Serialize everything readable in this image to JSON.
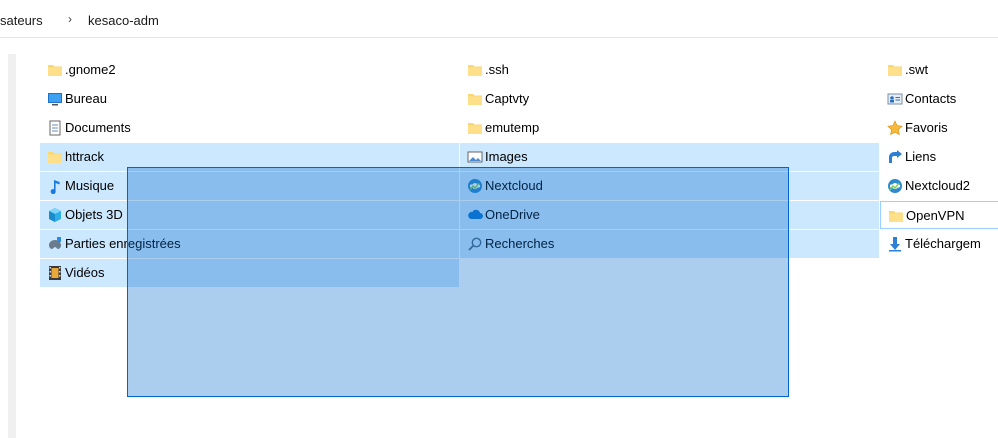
{
  "breadcrumb": {
    "segments": [
      "sateurs",
      "kesaco-adm"
    ],
    "separator": "›"
  },
  "columns": [
    [
      {
        "label": ".gnome2",
        "icon": "folder-icon",
        "selected": false
      },
      {
        "label": "Bureau",
        "icon": "desktop-icon",
        "selected": false
      },
      {
        "label": "Documents",
        "icon": "documents-icon",
        "selected": false
      },
      {
        "label": "httrack",
        "icon": "folder-icon",
        "selected": true
      },
      {
        "label": "Musique",
        "icon": "music-icon",
        "selected": true
      },
      {
        "label": "Objets 3D",
        "icon": "objects-3d-icon",
        "selected": true
      },
      {
        "label": "Parties enregistrées",
        "icon": "saved-games-icon",
        "selected": true
      },
      {
        "label": "Vidéos",
        "icon": "videos-icon",
        "selected": true
      }
    ],
    [
      {
        "label": ".ssh",
        "icon": "folder-icon",
        "selected": false
      },
      {
        "label": "Captvty",
        "icon": "folder-icon",
        "selected": false
      },
      {
        "label": "emutemp",
        "icon": "folder-icon",
        "selected": false
      },
      {
        "label": "Images",
        "icon": "pictures-icon",
        "selected": true
      },
      {
        "label": "Nextcloud",
        "icon": "nextcloud-icon",
        "selected": true
      },
      {
        "label": "OneDrive",
        "icon": "onedrive-icon",
        "selected": true
      },
      {
        "label": "Recherches",
        "icon": "searches-icon",
        "selected": true
      }
    ],
    [
      {
        "label": ".swt",
        "icon": "folder-icon",
        "selected": false
      },
      {
        "label": "Contacts",
        "icon": "contacts-icon",
        "selected": false
      },
      {
        "label": "Favoris",
        "icon": "favorites-icon",
        "selected": false
      },
      {
        "label": "Liens",
        "icon": "links-icon",
        "selected": false
      },
      {
        "label": "Nextcloud2",
        "icon": "nextcloud-icon",
        "selected": false
      },
      {
        "label": "OpenVPN",
        "icon": "folder-icon",
        "selected": false
      },
      {
        "label": "Téléchargem",
        "icon": "downloads-icon",
        "selected": false
      }
    ]
  ],
  "colors": {
    "selection_fill": "#cce8ff",
    "marquee_fill": "rgba(0,102,204,0.33)",
    "marquee_border": "#0066cc",
    "folder_yellow": "#ffd866"
  }
}
